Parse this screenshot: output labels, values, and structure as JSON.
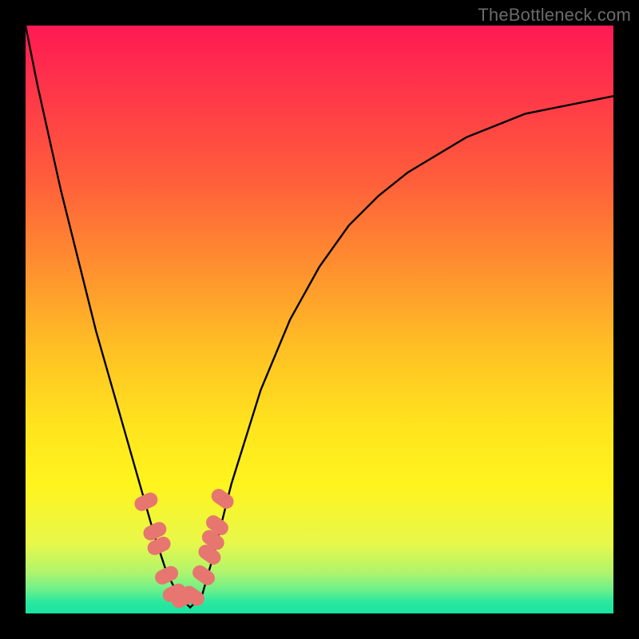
{
  "watermark": "TheBottleneck.com",
  "colors": {
    "frame": "#000000",
    "curve": "#000000",
    "marker": "#e6766f",
    "gradient_top": "#ff1a54",
    "gradient_bottom": "#18e4a4"
  },
  "chart_data": {
    "type": "line",
    "title": "",
    "xlabel": "",
    "ylabel": "",
    "xlim": [
      0,
      100
    ],
    "ylim": [
      0,
      100
    ],
    "series": [
      {
        "name": "bottleneck-curve",
        "x": [
          0,
          2,
          4,
          6,
          8,
          10,
          12,
          14,
          16,
          18,
          20,
          22,
          24,
          26,
          28,
          30,
          32,
          35,
          40,
          45,
          50,
          55,
          60,
          65,
          70,
          75,
          80,
          85,
          90,
          95,
          100
        ],
        "y": [
          100,
          90,
          81,
          72,
          64,
          56,
          48,
          41,
          34,
          27,
          20,
          13,
          7,
          3,
          1,
          3,
          10,
          22,
          38,
          50,
          59,
          66,
          71,
          75,
          78,
          81,
          83,
          85,
          86,
          87,
          88
        ]
      }
    ],
    "markers": {
      "name": "highlighted-points",
      "x": [
        20.5,
        22.0,
        22.7,
        24.0,
        25.3,
        26.8,
        28.5,
        30.3,
        31.3,
        31.9,
        32.6,
        33.5
      ],
      "y": [
        19.0,
        14.0,
        11.5,
        6.5,
        3.5,
        2.5,
        3.0,
        6.5,
        10.0,
        12.5,
        15.0,
        19.5
      ]
    }
  }
}
